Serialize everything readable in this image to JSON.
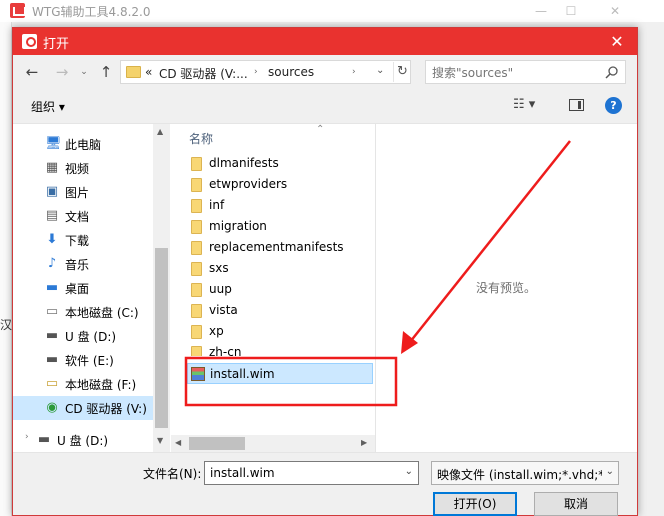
{
  "background_window": {
    "title": "WTG辅助工具4.8.2.0",
    "left_fragments": [
      "汉"
    ]
  },
  "dialog": {
    "title": "打开",
    "address": {
      "chevrons": "«",
      "segment1": "CD 驱动器 (V:...",
      "segment2": "sources"
    },
    "search_placeholder": "搜索\"sources\"",
    "organize_label": "组织 ▾",
    "nav_items": [
      {
        "label": "此电脑",
        "icon": "computer-icon"
      },
      {
        "label": "视频",
        "icon": "video-icon"
      },
      {
        "label": "图片",
        "icon": "pictures-icon"
      },
      {
        "label": "文档",
        "icon": "documents-icon"
      },
      {
        "label": "下载",
        "icon": "download-icon"
      },
      {
        "label": "音乐",
        "icon": "music-icon"
      },
      {
        "label": "桌面",
        "icon": "desktop-icon"
      },
      {
        "label": "本地磁盘 (C:)",
        "icon": "drive-icon"
      },
      {
        "label": "U 盘 (D:)",
        "icon": "usb-drive-icon"
      },
      {
        "label": "软件 (E:)",
        "icon": "drive-icon"
      },
      {
        "label": "本地磁盘 (F:)",
        "icon": "drive-icon"
      },
      {
        "label": "CD 驱动器 (V:)",
        "icon": "cd-drive-icon"
      },
      {
        "label": "U 盘 (D:)",
        "icon": "usb-drive-icon"
      }
    ],
    "column_header": "名称",
    "files": [
      {
        "name": "dlmanifests",
        "type": "folder"
      },
      {
        "name": "etwproviders",
        "type": "folder"
      },
      {
        "name": "inf",
        "type": "folder"
      },
      {
        "name": "migration",
        "type": "folder"
      },
      {
        "name": "replacementmanifests",
        "type": "folder"
      },
      {
        "name": "sxs",
        "type": "folder"
      },
      {
        "name": "uup",
        "type": "folder"
      },
      {
        "name": "vista",
        "type": "folder"
      },
      {
        "name": "xp",
        "type": "folder"
      },
      {
        "name": "zh-cn",
        "type": "folder"
      },
      {
        "name": "install.wim",
        "type": "wim"
      }
    ],
    "no_preview": "没有预览。",
    "filename_label": "文件名(N):",
    "filename_value": "install.wim",
    "filetype_value": "映像文件 (install.wim;*.vhd;*.v",
    "open_label": "打开(O)",
    "cancel_label": "取消"
  },
  "colors": {
    "titlebar": "#e9322f",
    "selection": "#cce8ff",
    "annotation": "#ee1c1c"
  }
}
